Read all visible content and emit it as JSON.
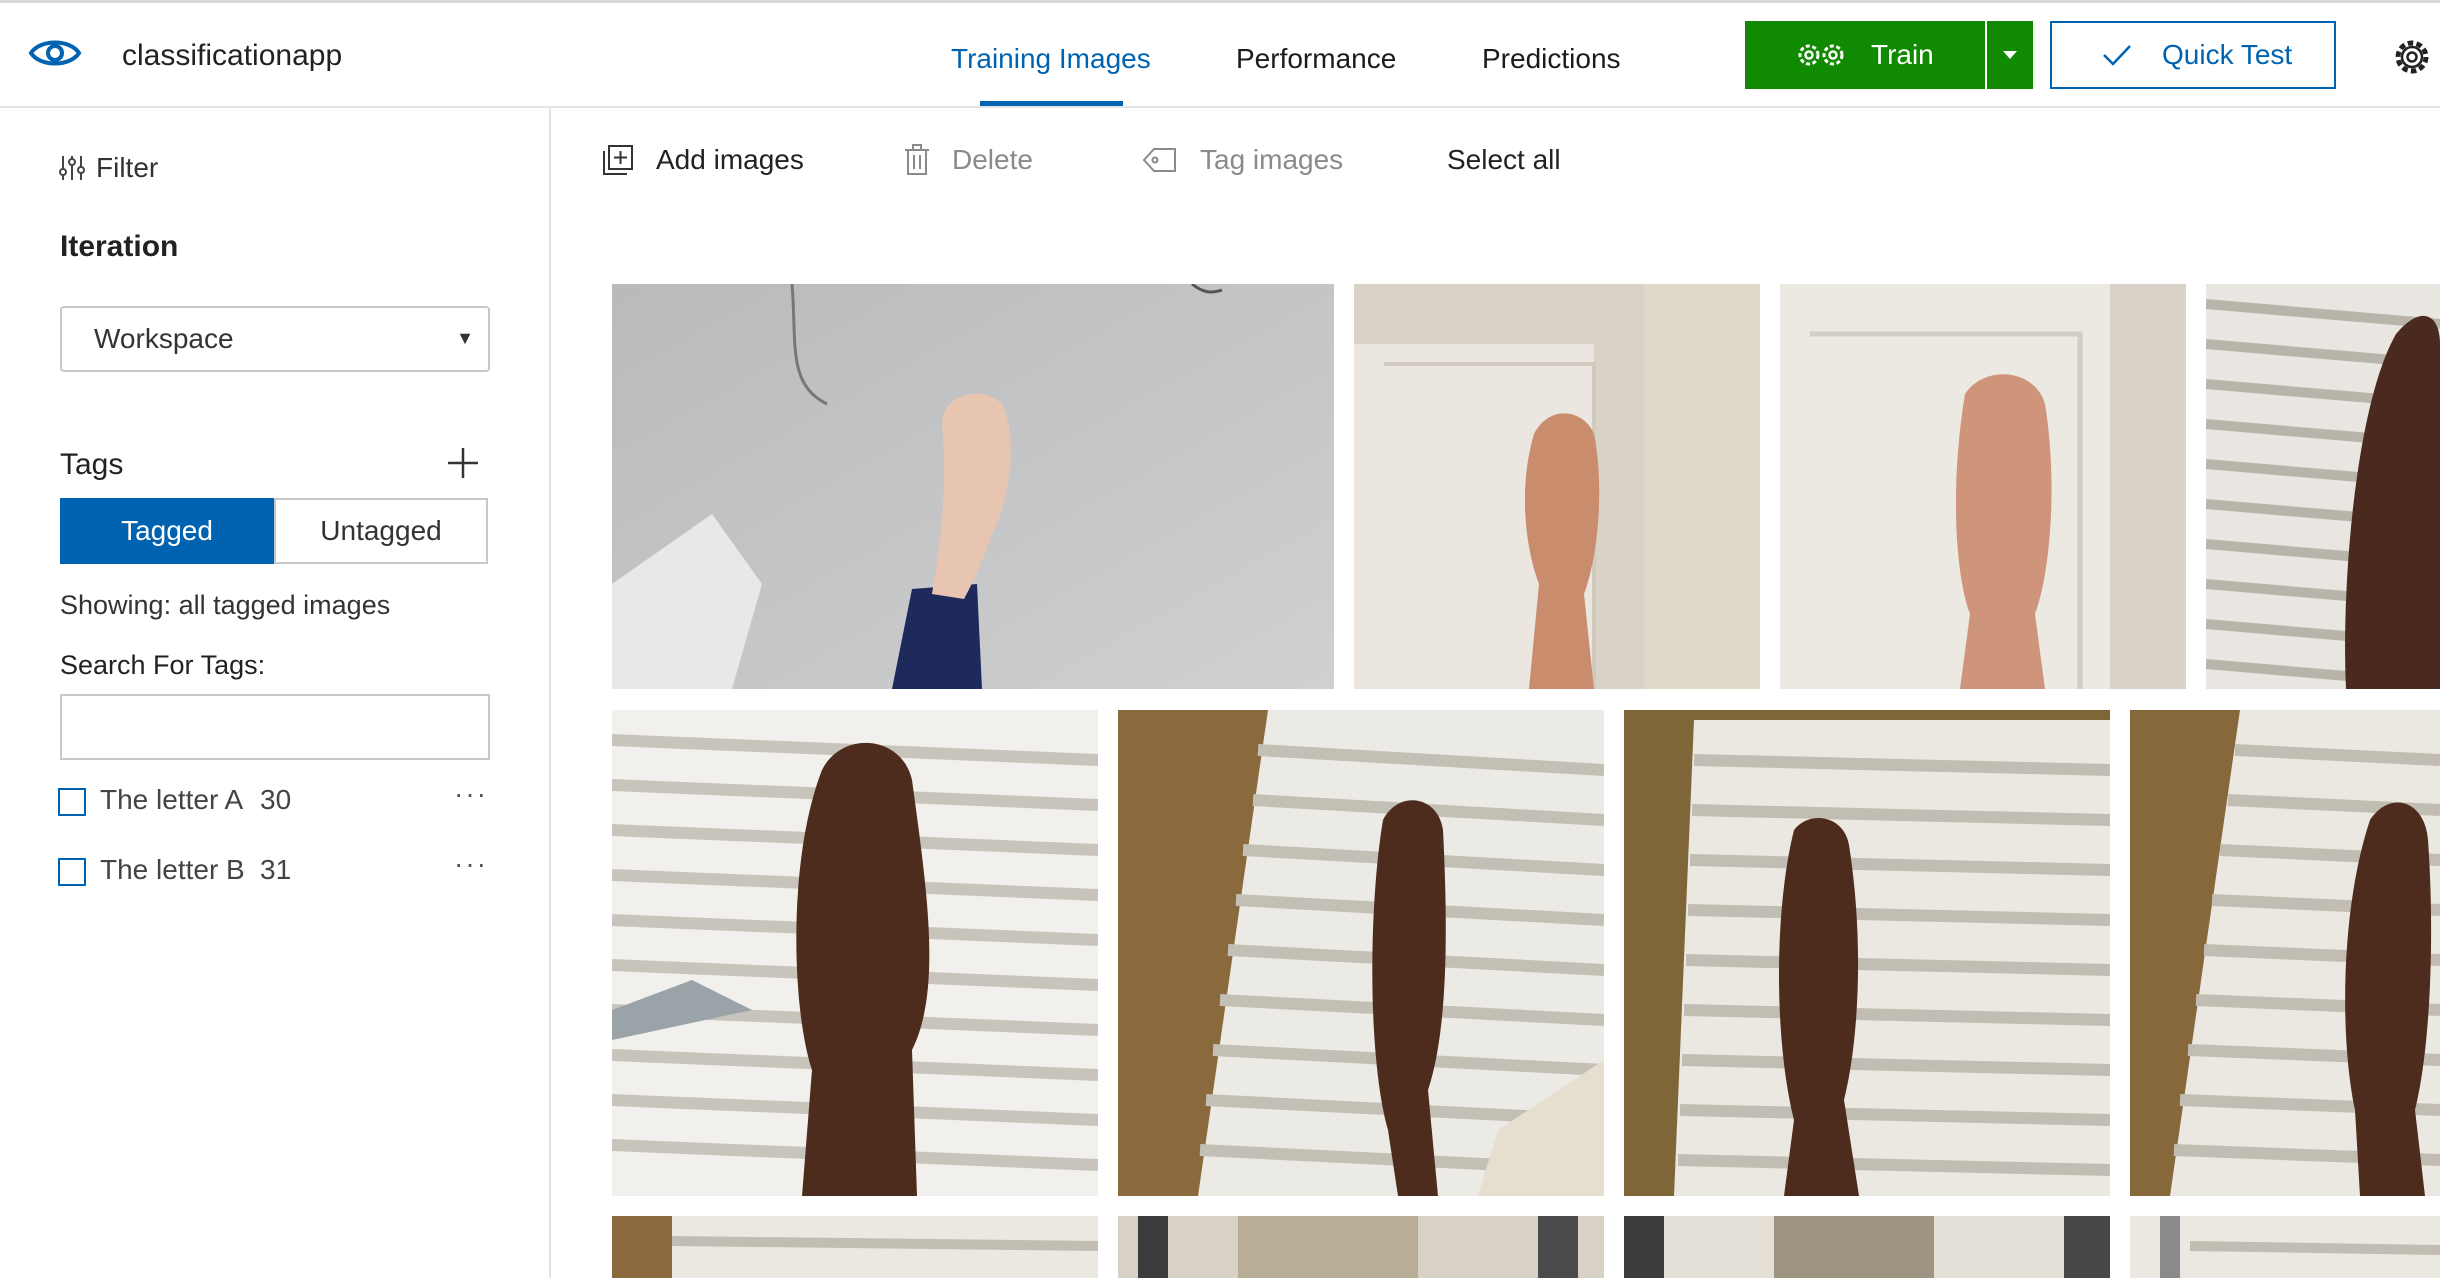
{
  "app": {
    "name": "classificationapp"
  },
  "nav": {
    "tabs": [
      {
        "label": "Training Images",
        "active": true
      },
      {
        "label": "Performance",
        "active": false
      },
      {
        "label": "Predictions",
        "active": false
      }
    ],
    "train_label": "Train",
    "quick_test_label": "Quick Test"
  },
  "colors": {
    "accent": "#0063b1",
    "train": "#108a00"
  },
  "sidebar": {
    "filter_label": "Filter",
    "iteration_label": "Iteration",
    "iteration_value": "Workspace",
    "tags_label": "Tags",
    "segment": {
      "tagged": "Tagged",
      "untagged": "Untagged"
    },
    "showing_text": "Showing: all tagged images",
    "search_label": "Search For Tags:",
    "search_value": "",
    "tags": [
      {
        "name": "The letter A",
        "count": "30"
      },
      {
        "name": "The letter B",
        "count": "31"
      }
    ]
  },
  "toolbar": {
    "add_images": "Add images",
    "delete": "Delete",
    "tag_images": "Tag images",
    "select_all": "Select all"
  },
  "icons": {
    "logo": "eye-icon",
    "train": "gears-icon",
    "quick_test": "checkmark-icon",
    "settings": "gear-icon",
    "filter": "sliders-icon",
    "add": "plus-icon",
    "add_images": "add-image-icon",
    "delete": "trash-icon",
    "tag": "tag-icon",
    "more": "ellipsis-icon"
  }
}
